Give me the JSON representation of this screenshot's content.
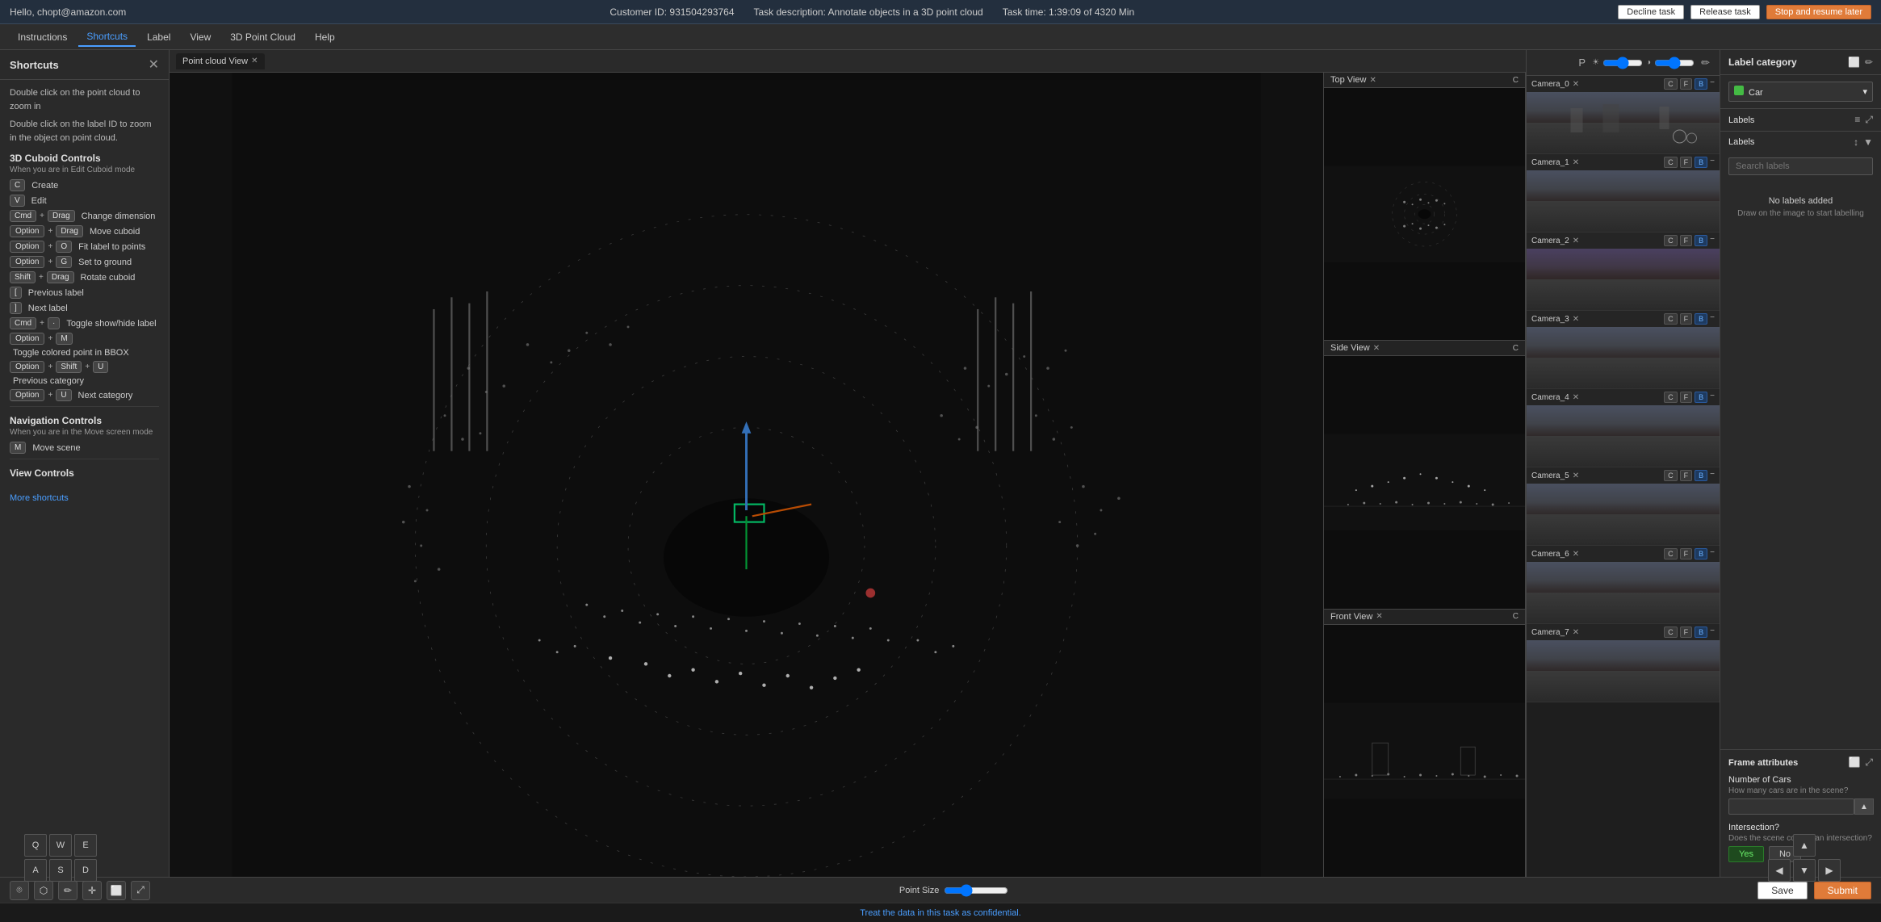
{
  "topbar": {
    "user": "Hello, chopt@amazon.com",
    "customer_id_label": "Customer ID:",
    "customer_id": "931504293764",
    "task_desc_label": "Task description:",
    "task_desc": "Annotate objects in a 3D point cloud",
    "task_time_label": "Task time:",
    "task_time": "1:39:09 of 4320 Min",
    "decline_btn": "Decline task",
    "release_btn": "Release task",
    "stop_btn": "Stop and resume later"
  },
  "navbar": {
    "items": [
      {
        "id": "instructions",
        "label": "Instructions"
      },
      {
        "id": "shortcuts",
        "label": "Shortcuts"
      },
      {
        "id": "label",
        "label": "Label"
      },
      {
        "id": "view",
        "label": "View"
      },
      {
        "id": "3dpc",
        "label": "3D Point Cloud"
      },
      {
        "id": "help",
        "label": "Help"
      }
    ],
    "active": "shortcuts"
  },
  "sidebar": {
    "title": "Shortcuts",
    "desc1": "Double click on the point cloud to zoom in",
    "desc2": "Double click on the label ID to zoom in the object on point cloud.",
    "cuboid_title": "3D Cuboid Controls",
    "cuboid_sub": "When you are in Edit Cuboid mode",
    "shortcuts": [
      {
        "keys": [
          "C"
        ],
        "label": "Create"
      },
      {
        "keys": [
          "V"
        ],
        "label": "Edit"
      },
      {
        "keys": [
          "Cmd",
          "+",
          "Drag"
        ],
        "label": "Change dimension"
      },
      {
        "keys": [
          "Option",
          "+",
          "Drag"
        ],
        "label": "Move cuboid"
      },
      {
        "keys": [
          "Option",
          "+",
          "O"
        ],
        "label": "Fit label to points"
      },
      {
        "keys": [
          "Option",
          "+",
          "G"
        ],
        "label": "Set to ground"
      },
      {
        "keys": [
          "Shift",
          "+",
          "Drag"
        ],
        "label": "Rotate cuboid"
      },
      {
        "keys": [
          "["
        ],
        "label": "Previous label"
      },
      {
        "keys": [
          "]"
        ],
        "label": "Next label"
      },
      {
        "keys": [
          "Cmd",
          "+",
          "·"
        ],
        "label": "Toggle show/hide label"
      },
      {
        "keys": [
          "Option",
          "+",
          "M"
        ],
        "label": "Toggle colored point in BBOX"
      },
      {
        "keys": [
          "Option",
          "+",
          "Shift",
          "+",
          "U"
        ],
        "label": "Previous category"
      },
      {
        "keys": [
          "Option",
          "+",
          "U"
        ],
        "label": "Next category"
      }
    ],
    "nav_title": "Navigation Controls",
    "nav_sub": "When you are in the Move screen mode",
    "nav_shortcuts": [
      {
        "keys": [
          "M"
        ],
        "label": "Move scene"
      }
    ],
    "view_title": "View Controls",
    "more_shortcuts": "More shortcuts"
  },
  "pointcloud_panel": {
    "tab_label": "Point cloud View"
  },
  "top_view": {
    "title": "Top View"
  },
  "side_view": {
    "title": "Side View"
  },
  "front_view": {
    "title": "Front View"
  },
  "camera_views": {
    "cameras": [
      {
        "id": "camera_0",
        "label": "Camera_0"
      },
      {
        "id": "camera_1",
        "label": "Camera_1"
      },
      {
        "id": "camera_2",
        "label": "Camera_2"
      },
      {
        "id": "camera_3",
        "label": "Camera_3"
      },
      {
        "id": "camera_4",
        "label": "Camera_4"
      },
      {
        "id": "camera_5",
        "label": "Camera_5"
      },
      {
        "id": "camera_6",
        "label": "Camera_6"
      },
      {
        "id": "camera_7",
        "label": "Camera_7"
      }
    ]
  },
  "right_panel": {
    "label_category_title": "Label category",
    "selected_category": "Car",
    "labels_title": "Labels",
    "search_placeholder": "Search labels",
    "no_labels_title": "No labels added",
    "no_labels_sub": "Draw on the image to start labelling",
    "frame_attr_title": "Frame attributes",
    "num_cars_label": "Number of Cars",
    "num_cars_sub": "How many cars are in the scene?",
    "intersection_label": "Intersection?",
    "intersection_sub": "Does the scene contain an intersection?",
    "yes_label": "Yes",
    "no_label": "No"
  },
  "toolbar": {
    "point_size_label": "Point Size",
    "save_label": "Save",
    "submit_label": "Submit"
  },
  "footer": {
    "text": "Treat the data in this task as confidential."
  }
}
